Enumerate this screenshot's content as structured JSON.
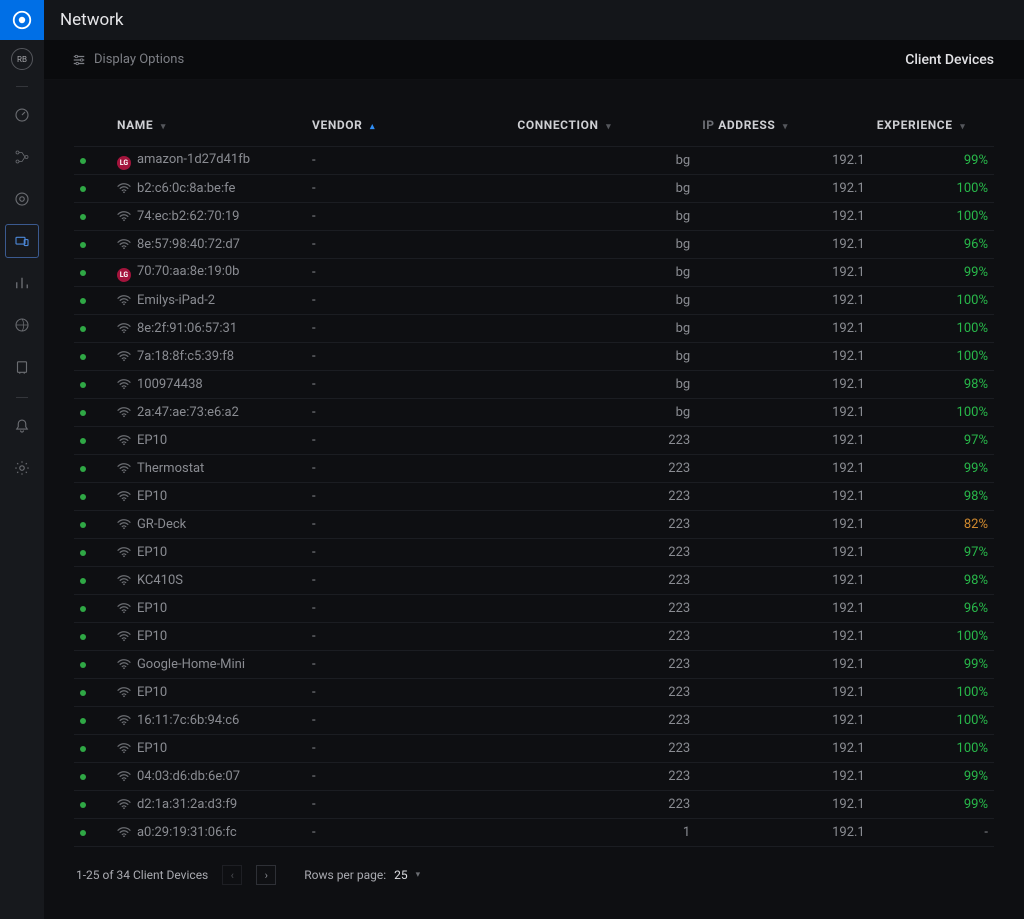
{
  "page": {
    "title": "Network"
  },
  "subheader": {
    "display_options_label": "Display Options",
    "tab_client_devices": "Client Devices"
  },
  "columns": {
    "name": "NAME",
    "vendor": "VENDOR",
    "connection": "CONNECTION",
    "ip": "ADDRESS",
    "ip_prefix": "IP",
    "experience": "EXPERIENCE"
  },
  "rows": [
    {
      "name": "amazon-1d27d41fb",
      "vendor": "-",
      "conn": "bg",
      "ip": "192.1",
      "exp": "99%",
      "icon": "lg",
      "exp_class": "good"
    },
    {
      "name": "b2:c6:0c:8a:be:fe",
      "vendor": "-",
      "conn": "bg",
      "ip": "192.1",
      "exp": "100%",
      "icon": "wifi",
      "exp_class": "good"
    },
    {
      "name": "74:ec:b2:62:70:19",
      "vendor": "-",
      "conn": "bg",
      "ip": "192.1",
      "exp": "100%",
      "icon": "wifi",
      "exp_class": "good"
    },
    {
      "name": "8e:57:98:40:72:d7",
      "vendor": "-",
      "conn": "bg",
      "ip": "192.1",
      "exp": "96%",
      "icon": "wifi",
      "exp_class": "good"
    },
    {
      "name": "70:70:aa:8e:19:0b",
      "vendor": "-",
      "conn": "bg",
      "ip": "192.1",
      "exp": "99%",
      "icon": "lg",
      "exp_class": "good"
    },
    {
      "name": "Emilys-iPad-2",
      "vendor": "-",
      "conn": "bg",
      "ip": "192.1",
      "exp": "100%",
      "icon": "wifi",
      "exp_class": "good"
    },
    {
      "name": "8e:2f:91:06:57:31",
      "vendor": "-",
      "conn": "bg",
      "ip": "192.1",
      "exp": "100%",
      "icon": "wifi",
      "exp_class": "good"
    },
    {
      "name": "7a:18:8f:c5:39:f8",
      "vendor": "-",
      "conn": "bg",
      "ip": "192.1",
      "exp": "100%",
      "icon": "wifi",
      "exp_class": "good"
    },
    {
      "name": "100974438",
      "vendor": "-",
      "conn": "bg",
      "ip": "192.1",
      "exp": "98%",
      "icon": "wifi",
      "exp_class": "good"
    },
    {
      "name": "2a:47:ae:73:e6:a2",
      "vendor": "-",
      "conn": "bg",
      "ip": "192.1",
      "exp": "100%",
      "icon": "wifi",
      "exp_class": "good"
    },
    {
      "name": "EP10",
      "vendor": "-",
      "conn": "223",
      "ip": "192.1",
      "exp": "97%",
      "icon": "wifi",
      "exp_class": "good"
    },
    {
      "name": "Thermostat",
      "vendor": "-",
      "conn": "223",
      "ip": "192.1",
      "exp": "99%",
      "icon": "wifi",
      "exp_class": "good"
    },
    {
      "name": "EP10",
      "vendor": "-",
      "conn": "223",
      "ip": "192.1",
      "exp": "98%",
      "icon": "wifi",
      "exp_class": "good"
    },
    {
      "name": "GR-Deck",
      "vendor": "-",
      "conn": "223",
      "ip": "192.1",
      "exp": "82%",
      "icon": "wifi",
      "exp_class": "warn"
    },
    {
      "name": "EP10",
      "vendor": "-",
      "conn": "223",
      "ip": "192.1",
      "exp": "97%",
      "icon": "wifi",
      "exp_class": "good"
    },
    {
      "name": "KC410S",
      "vendor": "-",
      "conn": "223",
      "ip": "192.1",
      "exp": "98%",
      "icon": "wifi",
      "exp_class": "good"
    },
    {
      "name": "EP10",
      "vendor": "-",
      "conn": "223",
      "ip": "192.1",
      "exp": "96%",
      "icon": "wifi",
      "exp_class": "good"
    },
    {
      "name": "EP10",
      "vendor": "-",
      "conn": "223",
      "ip": "192.1",
      "exp": "100%",
      "icon": "wifi",
      "exp_class": "good"
    },
    {
      "name": "Google-Home-Mini",
      "vendor": "-",
      "conn": "223",
      "ip": "192.1",
      "exp": "99%",
      "icon": "wifi",
      "exp_class": "good"
    },
    {
      "name": "EP10",
      "vendor": "-",
      "conn": "223",
      "ip": "192.1",
      "exp": "100%",
      "icon": "wifi",
      "exp_class": "good"
    },
    {
      "name": "16:11:7c:6b:94:c6",
      "vendor": "-",
      "conn": "223",
      "ip": "192.1",
      "exp": "100%",
      "icon": "wifi",
      "exp_class": "good"
    },
    {
      "name": "EP10",
      "vendor": "-",
      "conn": "223",
      "ip": "192.1",
      "exp": "100%",
      "icon": "wifi",
      "exp_class": "good"
    },
    {
      "name": "04:03:d6:db:6e:07",
      "vendor": "-",
      "conn": "223",
      "ip": "192.1",
      "exp": "99%",
      "icon": "wifi",
      "exp_class": "good"
    },
    {
      "name": "d2:1a:31:2a:d3:f9",
      "vendor": "-",
      "conn": "223",
      "ip": "192.1",
      "exp": "99%",
      "icon": "wifi",
      "exp_class": "good"
    },
    {
      "name": "a0:29:19:31:06:fc",
      "vendor": "-",
      "conn": "1",
      "ip": "192.1",
      "exp": "-",
      "icon": "wifi",
      "exp_class": "none"
    }
  ],
  "pager": {
    "range_text": "1-25 of 34 Client Devices",
    "rows_per_label": "Rows per page:",
    "rows_per_value": "25"
  },
  "nav_avatar": "RB"
}
